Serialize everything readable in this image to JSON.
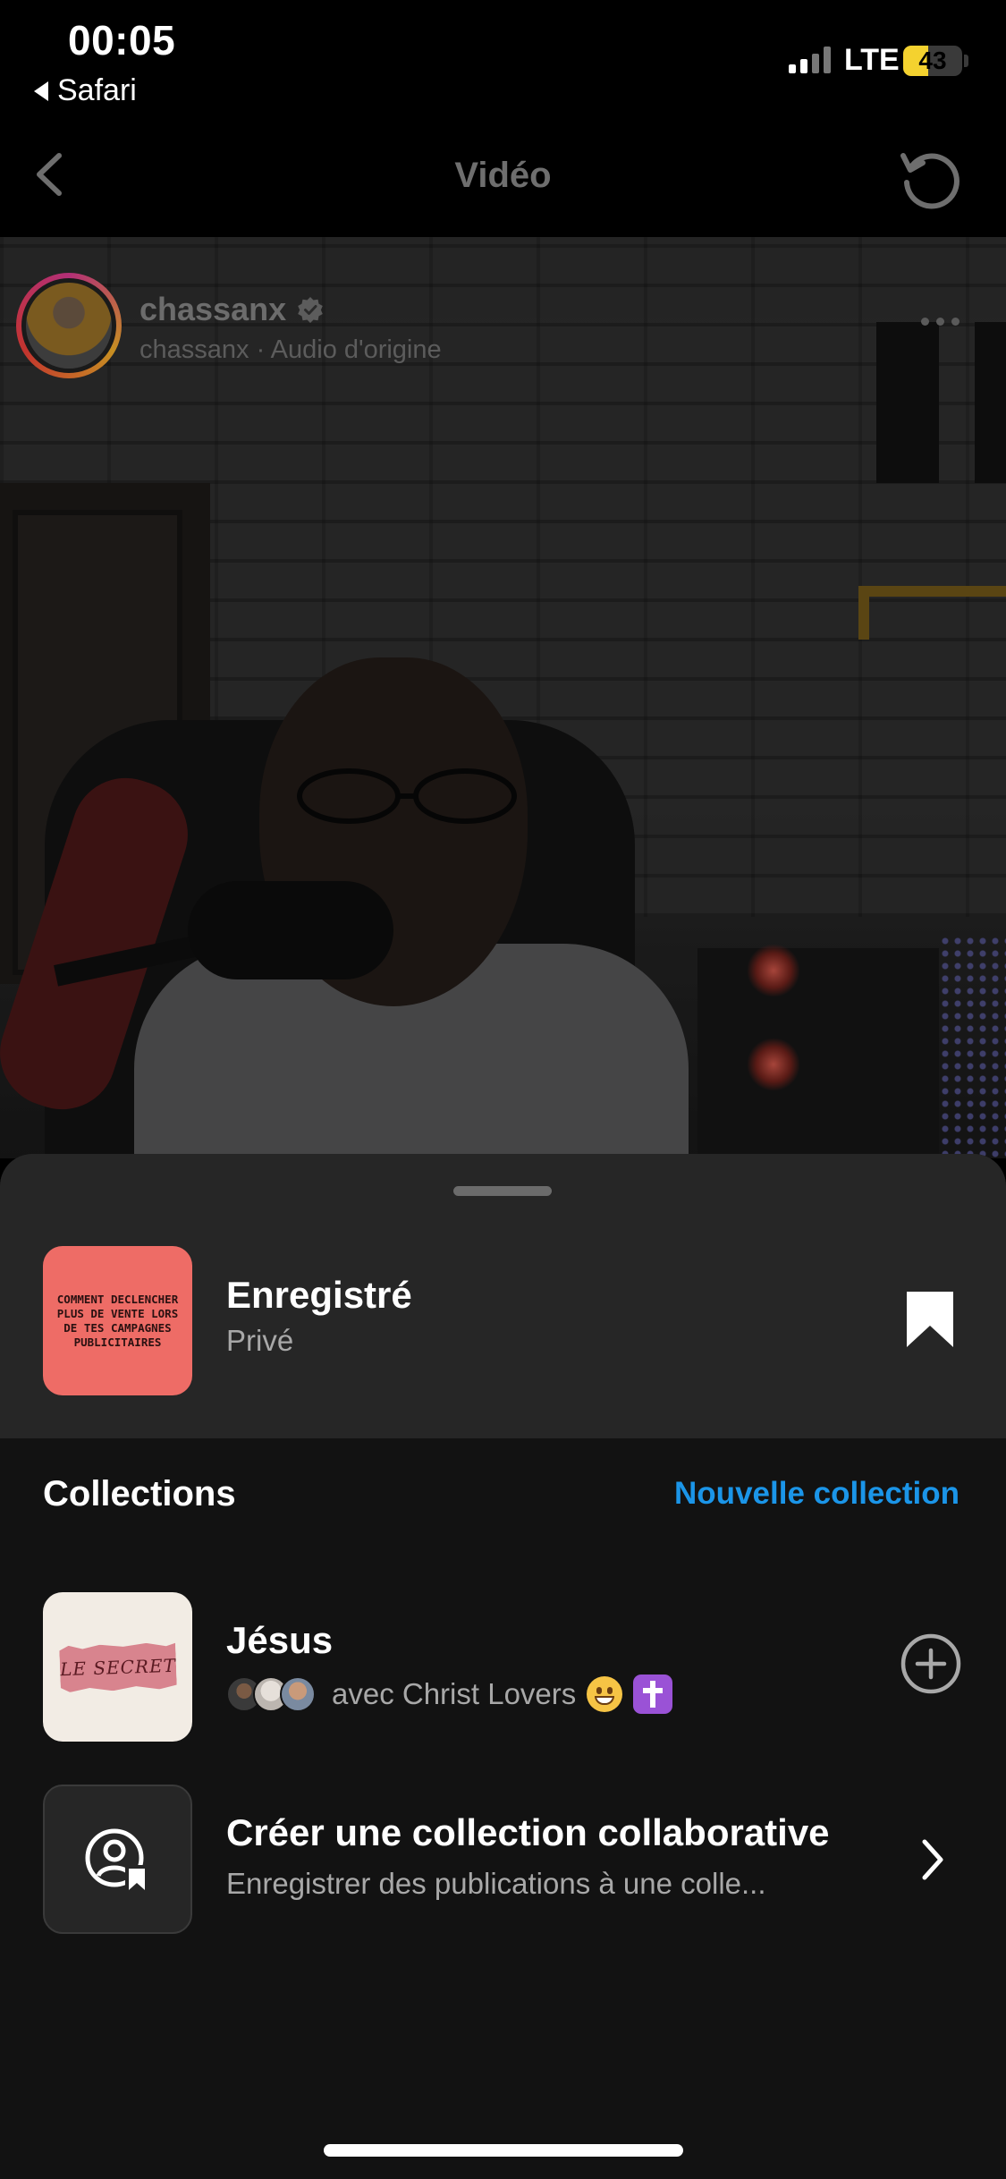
{
  "status_bar": {
    "time": "00:05",
    "back_app": "Safari",
    "network": "LTE",
    "battery_percent": 43,
    "battery_label": "43"
  },
  "nav": {
    "title": "Vidéo",
    "back_icon": "chevron-left-icon",
    "refresh_icon": "refresh-icon"
  },
  "post": {
    "username": "chassanx",
    "subtitle": "chassanx · Audio d'origine",
    "verified_icon": "verified-badge-icon",
    "more_icon": "more-horizontal-icon"
  },
  "sheet": {
    "saved": {
      "title": "Enregistré",
      "subtitle": "Privé",
      "thumb_text": "COMMENT DECLENCHER PLUS DE VENTE LORS DE TES CAMPAGNES PUBLICITAIRES",
      "bookmark_icon": "bookmark-filled-icon"
    },
    "collections_label": "Collections",
    "new_collection_label": "Nouvelle collection",
    "items": [
      {
        "title": "Jésus",
        "subtitle": "avec Christ Lovers",
        "thumb_text": "LE SECRET",
        "action_icon": "add-circle-icon"
      },
      {
        "title": "Créer une collection collaborative",
        "subtitle": "Enregistrer des publications à une colle...",
        "icon": "collaborative-collection-icon",
        "action_icon": "chevron-right-icon"
      }
    ]
  },
  "colors": {
    "accent_blue": "#1b95e8",
    "sheet_bg": "#121212",
    "sheet_top_bg": "#262626",
    "battery": "#f4d22f"
  }
}
